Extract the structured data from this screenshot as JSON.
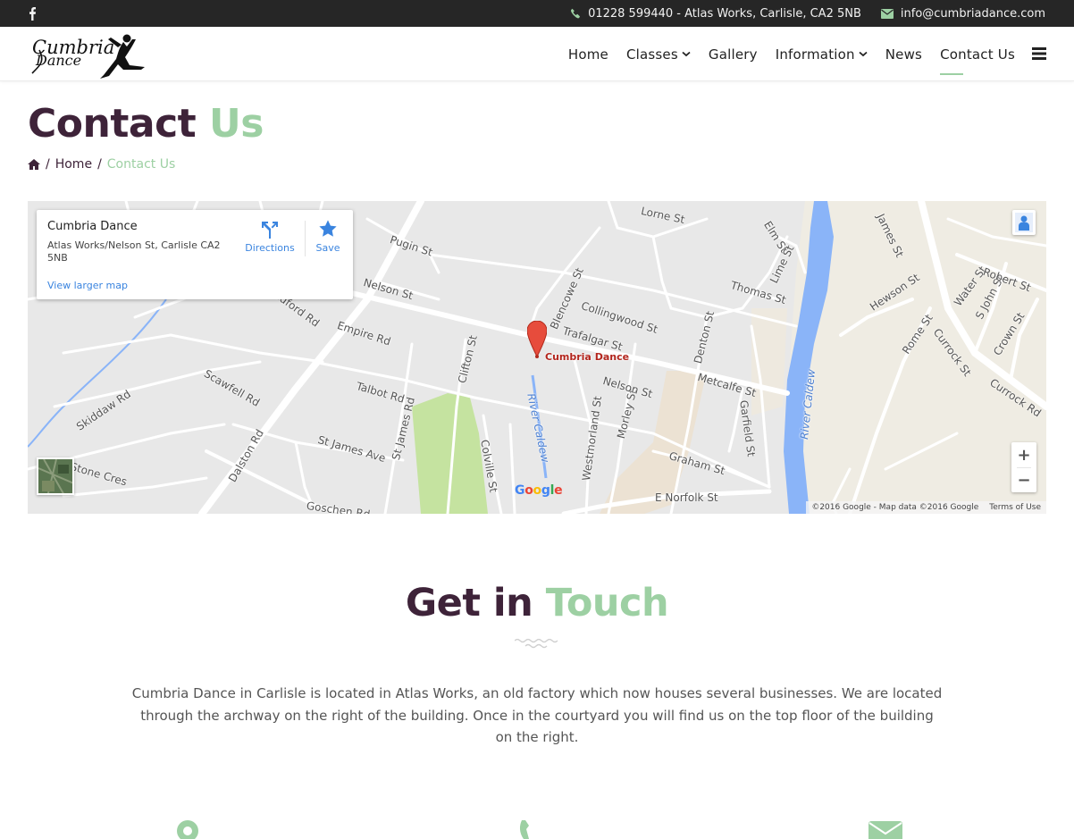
{
  "topbar": {
    "facebook_icon": "facebook-icon",
    "phone_text": "01228 599440 - Atlas Works, Carlisle, CA2 5NB",
    "email_text": "info@cumbriadance.com"
  },
  "header": {
    "logo_alt": "Cumbria Dance",
    "nav": [
      {
        "label": "Home"
      },
      {
        "label": "Classes"
      },
      {
        "label": "Gallery"
      },
      {
        "label": "Information"
      },
      {
        "label": "News"
      },
      {
        "label": "Contact Us"
      }
    ]
  },
  "page": {
    "title_main": "Contact",
    "title_accent": "Us",
    "breadcrumb_home": "Home",
    "breadcrumb_current": "Contact Us"
  },
  "map": {
    "card_name": "Cumbria Dance",
    "card_address": "Atlas Works/Nelson St, Carlisle CA2 5NB",
    "card_larger": "View larger map",
    "directions": "Directions",
    "save": "Save",
    "pin_label": "Cumbria Dance",
    "attribution": "©2016 Google - Map data ©2016 Google",
    "terms": "Terms of Use",
    "zoom_in": "+",
    "zoom_out": "−",
    "streets": [
      "Lorne St",
      "Pugin St",
      "Nelson St",
      "Blencowe St",
      "Collingwood St",
      "Trafalgar St",
      "Empire Rd",
      "Bedford Rd",
      "Clifton St",
      "Scawfell Rd",
      "Talbot Rd",
      "St James Rd",
      "Skiddaw Rd",
      "Dalston Rd",
      "St James Ave",
      "Colville St",
      "Westmorland St",
      "Morley St",
      "Nelson St",
      "Denton St",
      "Metcalfe St",
      "Garfield St",
      "Graham St",
      "E Norfolk St",
      "Goschen Rd",
      "Stone Cres",
      "Elm St",
      "Lime St",
      "Thomas St",
      "James St",
      "Hewson St",
      "Water St",
      "S John St",
      "Robert St",
      "Rome St",
      "Currock St",
      "Crown St",
      "Currock Rd",
      "River Caldew",
      "River Caldew"
    ]
  },
  "touch": {
    "title_main": "Get in",
    "title_accent": "Touch",
    "intro": "Cumbria Dance in Carlisle is located in Atlas Works, an old factory which now houses several businesses. We are located through the archway on the right of the building. Once in the courtyard you will find us on the top floor of the building on the right."
  },
  "colors": {
    "brand_dark": "#3e2339",
    "accent_green": "#9dd0a3",
    "topbar_bg": "#262626",
    "map_link": "#3a84df"
  }
}
